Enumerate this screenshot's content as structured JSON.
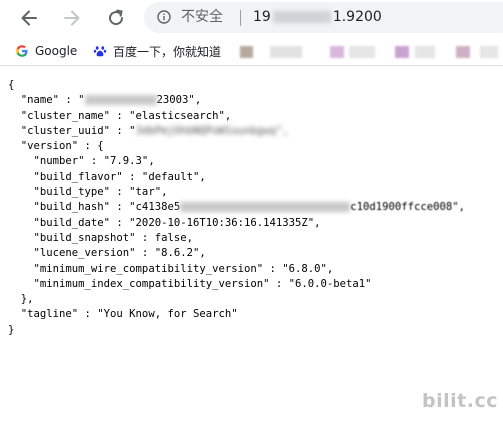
{
  "browser": {
    "security_label": "不安全",
    "url_start": "19",
    "url_end": "1.9200"
  },
  "bookmarks": [
    {
      "label": "Google",
      "icon": "google-g-icon"
    },
    {
      "label": "百度一下，你就知道",
      "icon": "baidu-paw-icon"
    }
  ],
  "json_lines": {
    "l0": "{",
    "l1": "  \"name\" : \"",
    "l1b": "23003\",",
    "l2": "  \"cluster_name\" : \"elasticsearch\",",
    "l3": "  \"cluster_uuid\" : \"",
    "l3b": "3dbPmjOhbNQPoW1ounbgwq\",",
    "l4": "  \"version\" : {",
    "l5": "    \"number\" : \"7.9.3\",",
    "l6": "    \"build_flavor\" : \"default\",",
    "l7": "    \"build_type\" : \"tar\",",
    "l8": "    \"build_hash\" : \"c4138e5",
    "l8b": "c10d1900ffcce008\",",
    "l9": "    \"build_date\" : \"2020-10-16T10:36:16.141335Z\",",
    "l10": "    \"build_snapshot\" : false,",
    "l11": "    \"lucene_version\" : \"8.6.2\",",
    "l12": "    \"minimum_wire_compatibility_version\" : \"6.8.0\",",
    "l13": "    \"minimum_index_compatibility_version\" : \"6.0.0-beta1\"",
    "l14": "  },",
    "l15": "  \"tagline\" : \"You Know, for Search\"",
    "l16": "}"
  },
  "watermark": "bilit.cc",
  "colors": {
    "omnibox_bg": "#f1f3f4",
    "icon_gray": "#5f6368",
    "disabled_gray": "#c4c7c5"
  }
}
